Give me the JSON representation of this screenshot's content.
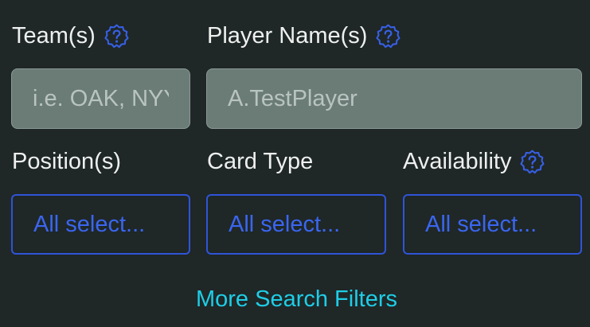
{
  "filters": {
    "teams": {
      "label": "Team(s)",
      "placeholder": "i.e. OAK, NYY",
      "help_icon": "question-badge-icon"
    },
    "player_names": {
      "label": "Player Name(s)",
      "placeholder": "A.TestPlayer",
      "help_icon": "question-badge-icon"
    },
    "positions": {
      "label": "Position(s)",
      "value": "All select..."
    },
    "card_type": {
      "label": "Card Type",
      "value": "All select..."
    },
    "availability": {
      "label": "Availability",
      "value": "All select...",
      "help_icon": "question-badge-icon"
    }
  },
  "more_filters_link": "More Search Filters",
  "colors": {
    "background": "#1f2727",
    "input_bg": "#6b7c77",
    "accent_blue": "#2f54d8",
    "link_cyan": "#1fcde6"
  }
}
